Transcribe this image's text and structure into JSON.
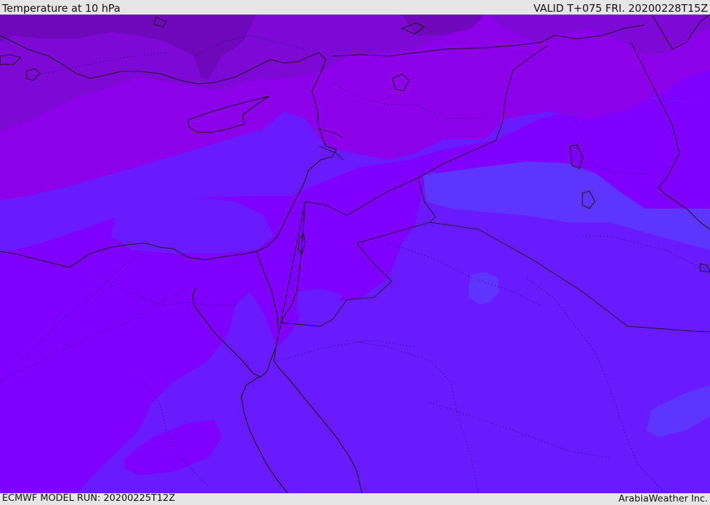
{
  "header": {
    "title": "Temperature at 10 hPa",
    "valid_time": "VALID T+075 FRI. 20200228T15Z"
  },
  "footer": {
    "model_run": "ECMWF MODEL RUN: 20200225T12Z",
    "credit": "ArabiaWeather Inc."
  },
  "map": {
    "region": "Eastern Mediterranean and Middle East",
    "colors": {
      "band_1": "#6f08bb",
      "band_2": "#7e08d6",
      "band_3": "#8c00ea",
      "band_4": "#8000ff",
      "band_5": "#6a1aff",
      "band_6": "#5e34ff",
      "coastline": "#1a1a1a",
      "border": "#1a1a1a"
    }
  }
}
